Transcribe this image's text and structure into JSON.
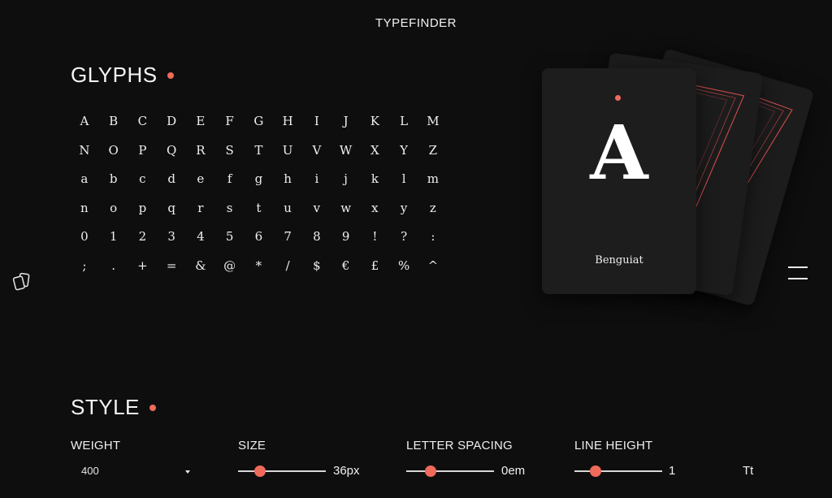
{
  "app": {
    "title": "TYPEFINDER"
  },
  "glyphs": {
    "title": "GLYPHS",
    "characters": [
      "A",
      "B",
      "C",
      "D",
      "E",
      "F",
      "G",
      "H",
      "I",
      "J",
      "K",
      "L",
      "M",
      "N",
      "O",
      "P",
      "Q",
      "R",
      "S",
      "T",
      "U",
      "V",
      "W",
      "X",
      "Y",
      "Z",
      "a",
      "b",
      "c",
      "d",
      "e",
      "f",
      "g",
      "h",
      "i",
      "j",
      "k",
      "l",
      "m",
      "n",
      "o",
      "p",
      "q",
      "r",
      "s",
      "t",
      "u",
      "v",
      "w",
      "x",
      "y",
      "z",
      "0",
      "1",
      "2",
      "3",
      "4",
      "5",
      "6",
      "7",
      "8",
      "9",
      "!",
      "?",
      ":",
      ";",
      ".",
      "+",
      "=",
      "&",
      "@",
      "*",
      "/",
      "$",
      "€",
      "£",
      "%",
      "^"
    ]
  },
  "card": {
    "letter": "A",
    "font_name": "Benguiat"
  },
  "style": {
    "title": "STYLE",
    "weight": {
      "label": "WEIGHT",
      "value": "400"
    },
    "size": {
      "label": "SIZE",
      "value": "36px",
      "level": 0.25
    },
    "letter_spacing": {
      "label": "LETTER SPACING",
      "value": "0em",
      "level": 0.28
    },
    "line_height": {
      "label": "LINE HEIGHT",
      "value": "1",
      "level": 0.24
    },
    "case_toggle": "Tt"
  },
  "icons": {
    "side": "cards-icon",
    "menu": "hamburger-menu-icon"
  },
  "colors": {
    "background": "#0e0e0f",
    "accent": "#ef6a5a",
    "card": "#1c1c1d"
  }
}
